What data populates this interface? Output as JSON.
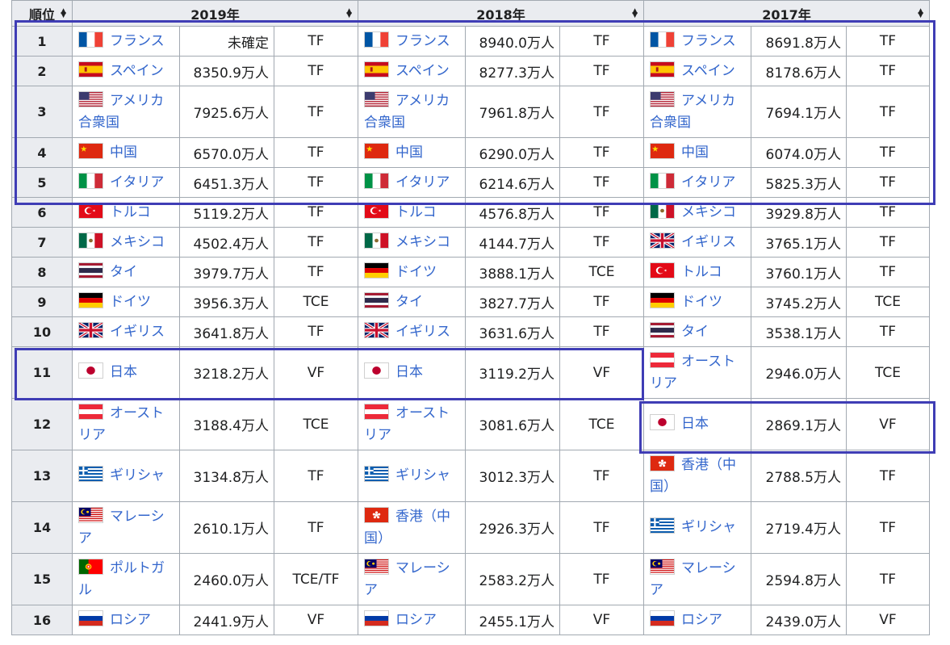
{
  "table": {
    "header": {
      "rank_label": "順位",
      "years": [
        "2019年",
        "2018年",
        "2017年"
      ]
    },
    "rows": [
      {
        "rank": "1",
        "c": [
          {
            "flag": "fr",
            "name": "フランス",
            "value": "未確定",
            "type": "TF"
          },
          {
            "flag": "fr",
            "name": "フランス",
            "value": "8940.0万人",
            "type": "TF"
          },
          {
            "flag": "fr",
            "name": "フランス",
            "value": "8691.8万人",
            "type": "TF"
          }
        ]
      },
      {
        "rank": "2",
        "c": [
          {
            "flag": "es",
            "name": "スペイン",
            "value": "8350.9万人",
            "type": "TF"
          },
          {
            "flag": "es",
            "name": "スペイン",
            "value": "8277.3万人",
            "type": "TF"
          },
          {
            "flag": "es",
            "name": "スペイン",
            "value": "8178.6万人",
            "type": "TF"
          }
        ]
      },
      {
        "rank": "3",
        "c": [
          {
            "flag": "us",
            "name": "アメリカ合衆国",
            "value": "7925.6万人",
            "type": "TF"
          },
          {
            "flag": "us",
            "name": "アメリカ合衆国",
            "value": "7961.8万人",
            "type": "TF"
          },
          {
            "flag": "us",
            "name": "アメリカ合衆国",
            "value": "7694.1万人",
            "type": "TF"
          }
        ]
      },
      {
        "rank": "4",
        "c": [
          {
            "flag": "cn",
            "name": "中国",
            "value": "6570.0万人",
            "type": "TF"
          },
          {
            "flag": "cn",
            "name": "中国",
            "value": "6290.0万人",
            "type": "TF"
          },
          {
            "flag": "cn",
            "name": "中国",
            "value": "6074.0万人",
            "type": "TF"
          }
        ]
      },
      {
        "rank": "5",
        "c": [
          {
            "flag": "it",
            "name": "イタリア",
            "value": "6451.3万人",
            "type": "TF"
          },
          {
            "flag": "it",
            "name": "イタリア",
            "value": "6214.6万人",
            "type": "TF"
          },
          {
            "flag": "it",
            "name": "イタリア",
            "value": "5825.3万人",
            "type": "TF"
          }
        ]
      },
      {
        "rank": "6",
        "c": [
          {
            "flag": "tr",
            "name": "トルコ",
            "value": "5119.2万人",
            "type": "TF"
          },
          {
            "flag": "tr",
            "name": "トルコ",
            "value": "4576.8万人",
            "type": "TF"
          },
          {
            "flag": "mx",
            "name": "メキシコ",
            "value": "3929.8万人",
            "type": "TF"
          }
        ]
      },
      {
        "rank": "7",
        "c": [
          {
            "flag": "mx",
            "name": "メキシコ",
            "value": "4502.4万人",
            "type": "TF"
          },
          {
            "flag": "mx",
            "name": "メキシコ",
            "value": "4144.7万人",
            "type": "TF"
          },
          {
            "flag": "gb",
            "name": "イギリス",
            "value": "3765.1万人",
            "type": "TF"
          }
        ]
      },
      {
        "rank": "8",
        "c": [
          {
            "flag": "th",
            "name": "タイ",
            "value": "3979.7万人",
            "type": "TF"
          },
          {
            "flag": "de",
            "name": "ドイツ",
            "value": "3888.1万人",
            "type": "TCE"
          },
          {
            "flag": "tr",
            "name": "トルコ",
            "value": "3760.1万人",
            "type": "TF"
          }
        ]
      },
      {
        "rank": "9",
        "c": [
          {
            "flag": "de",
            "name": "ドイツ",
            "value": "3956.3万人",
            "type": "TCE"
          },
          {
            "flag": "th",
            "name": "タイ",
            "value": "3827.7万人",
            "type": "TF"
          },
          {
            "flag": "de",
            "name": "ドイツ",
            "value": "3745.2万人",
            "type": "TCE"
          }
        ]
      },
      {
        "rank": "10",
        "c": [
          {
            "flag": "gb",
            "name": "イギリス",
            "value": "3641.8万人",
            "type": "TF"
          },
          {
            "flag": "gb",
            "name": "イギリス",
            "value": "3631.6万人",
            "type": "TF"
          },
          {
            "flag": "th",
            "name": "タイ",
            "value": "3538.1万人",
            "type": "TF"
          }
        ]
      },
      {
        "rank": "11",
        "c": [
          {
            "flag": "jp",
            "name": "日本",
            "value": "3218.2万人",
            "type": "VF"
          },
          {
            "flag": "jp",
            "name": "日本",
            "value": "3119.2万人",
            "type": "VF"
          },
          {
            "flag": "at",
            "name": "オーストリア",
            "value": "2946.0万人",
            "type": "TCE"
          }
        ]
      },
      {
        "rank": "12",
        "c": [
          {
            "flag": "at",
            "name": "オーストリア",
            "value": "3188.4万人",
            "type": "TCE"
          },
          {
            "flag": "at",
            "name": "オーストリア",
            "value": "3081.6万人",
            "type": "TCE"
          },
          {
            "flag": "jp",
            "name": "日本",
            "value": "2869.1万人",
            "type": "VF"
          }
        ]
      },
      {
        "rank": "13",
        "c": [
          {
            "flag": "gr",
            "name": "ギリシャ",
            "value": "3134.8万人",
            "type": "TF"
          },
          {
            "flag": "gr",
            "name": "ギリシャ",
            "value": "3012.3万人",
            "type": "TF"
          },
          {
            "flag": "hk",
            "name": "香港（中国）",
            "value": "2788.5万人",
            "type": "TF"
          }
        ]
      },
      {
        "rank": "14",
        "c": [
          {
            "flag": "my",
            "name": "マレーシア",
            "value": "2610.1万人",
            "type": "TF"
          },
          {
            "flag": "hk",
            "name": "香港（中国）",
            "value": "2926.3万人",
            "type": "TF"
          },
          {
            "flag": "gr",
            "name": "ギリシャ",
            "value": "2719.4万人",
            "type": "TF"
          }
        ]
      },
      {
        "rank": "15",
        "c": [
          {
            "flag": "pt",
            "name": "ポルトガル",
            "value": "2460.0万人",
            "type": "TCE/TF"
          },
          {
            "flag": "my",
            "name": "マレーシア",
            "value": "2583.2万人",
            "type": "TF"
          },
          {
            "flag": "my",
            "name": "マレーシア",
            "value": "2594.8万人",
            "type": "TF"
          }
        ]
      },
      {
        "rank": "16",
        "c": [
          {
            "flag": "ru",
            "name": "ロシア",
            "value": "2441.9万人",
            "type": "VF"
          },
          {
            "flag": "ru",
            "name": "ロシア",
            "value": "2455.1万人",
            "type": "VF"
          },
          {
            "flag": "ru",
            "name": "ロシア",
            "value": "2439.0万人",
            "type": "VF"
          }
        ]
      }
    ]
  },
  "colors": {
    "link": "#3366cc",
    "header_bg": "#eaecf0",
    "border": "#a2a9b1",
    "highlight": "#3f3db5"
  }
}
